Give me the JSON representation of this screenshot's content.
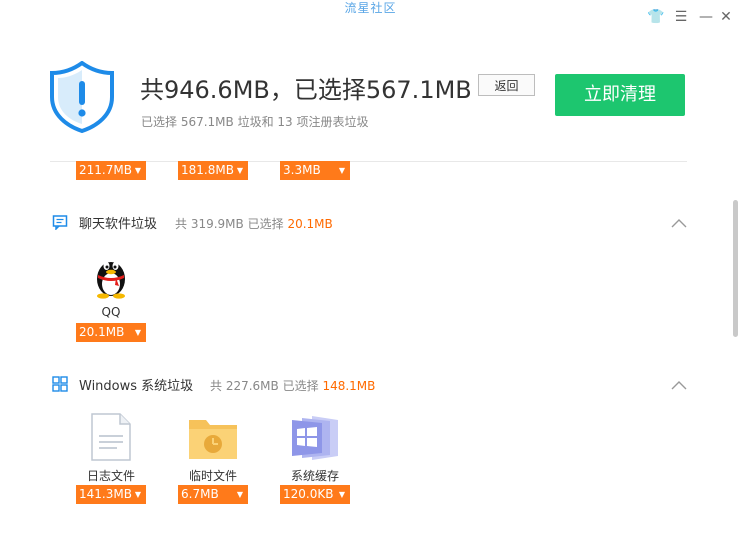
{
  "watermark": "流星社区",
  "window_controls": {
    "skin": "👕",
    "menu": "☰",
    "minimize": "—",
    "close": "✕"
  },
  "header": {
    "headline": "共946.6MB，已选择567.1MB",
    "back_button": "返回",
    "clean_button": "立即清理",
    "subline": "已选择 567.1MB 垃圾和 13 项注册表垃圾"
  },
  "top_row": {
    "sizes": [
      "211.7MB",
      "181.8MB",
      "3.3MB"
    ]
  },
  "sections": {
    "chat": {
      "title": "聊天软件垃圾",
      "total_prefix": "共 319.9MB",
      "selected_prefix": "已选择",
      "selected_value": "20.1MB",
      "items": [
        {
          "label": "QQ",
          "size": "20.1MB",
          "icon": "qq-penguin-icon"
        }
      ]
    },
    "windows": {
      "title": "Windows 系统垃圾",
      "total_prefix": "共 227.6MB",
      "selected_prefix": "已选择",
      "selected_value": "148.1MB",
      "items": [
        {
          "label": "日志文件",
          "size": "141.3MB",
          "icon": "document-icon"
        },
        {
          "label": "临时文件",
          "size": "6.7MB",
          "icon": "folder-clock-icon"
        },
        {
          "label": "系统缓存",
          "size": "120.0KB",
          "icon": "windows-stack-icon"
        }
      ]
    }
  },
  "colors": {
    "accent_orange": "#ff7a1a",
    "green_button": "#1dc66f",
    "shield_blue": "#1e8be8"
  }
}
